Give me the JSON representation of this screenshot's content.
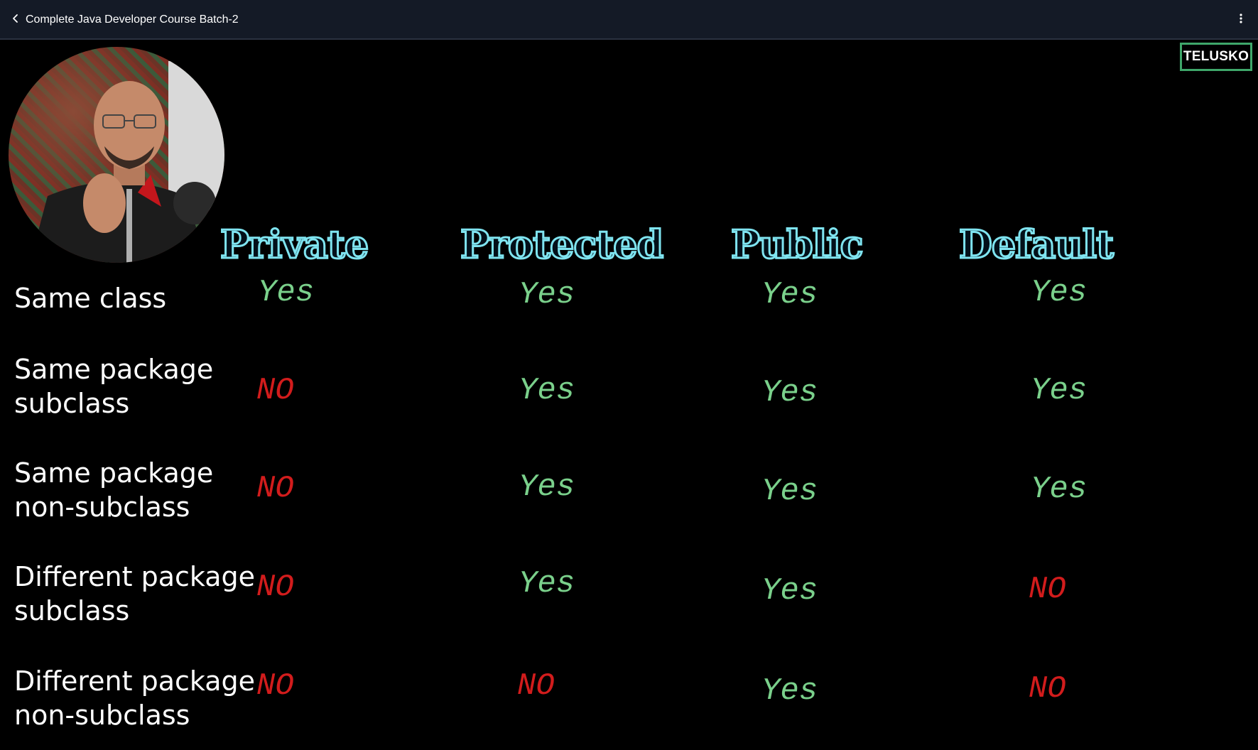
{
  "topbar": {
    "title": "Complete Java Developer Course Batch-2",
    "back_icon": "chevron-left-icon",
    "more_icon": "more-vertical-icon"
  },
  "video": {
    "brand": "TELUSKO",
    "table": {
      "columns": [
        "Private",
        "Protected",
        "Public",
        "Default"
      ],
      "rows": [
        {
          "label": "Same class",
          "values": [
            "Yes",
            "Yes",
            "Yes",
            "Yes"
          ]
        },
        {
          "label": "Same package\nsubclass",
          "values": [
            "NO",
            "Yes",
            "Yes",
            "Yes"
          ]
        },
        {
          "label": "Same package\nnon-subclass",
          "values": [
            "NO",
            "Yes",
            "Yes",
            "Yes"
          ]
        },
        {
          "label": "Different package\nsubclass",
          "values": [
            "NO",
            "Yes",
            "Yes",
            "NO"
          ]
        },
        {
          "label": "Different package\nnon-subclass",
          "values": [
            "NO",
            "NO",
            "Yes",
            "NO"
          ]
        }
      ]
    }
  },
  "colors": {
    "topbar_bg": "#141a26",
    "header_outline": "#7fe4f0",
    "yes": "#7ad08b",
    "no": "#d21c1c",
    "brand_border": "#3fa76a"
  }
}
